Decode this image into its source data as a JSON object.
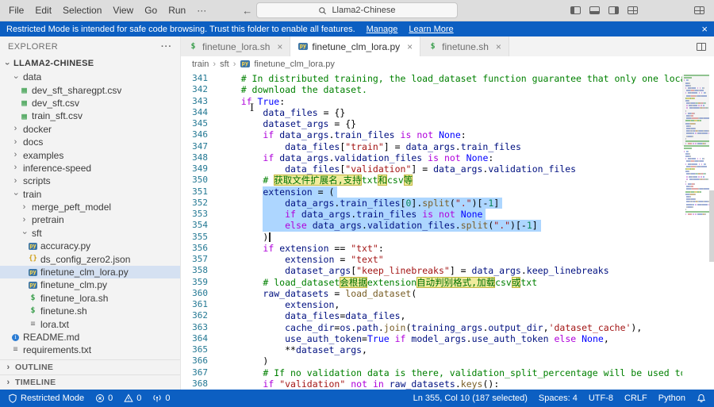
{
  "title_bar": {
    "menus": [
      "File",
      "Edit",
      "Selection",
      "View",
      "Go",
      "Run",
      "···"
    ],
    "search": "Llama2-Chinese"
  },
  "banner": {
    "text": "Restricted Mode is intended for safe code browsing. Trust this folder to enable all features.",
    "links": [
      "Manage",
      "Learn More"
    ]
  },
  "sidebar": {
    "header": "EXPLORER",
    "root": "LLAMA2-CHINESE",
    "items": [
      {
        "label": "data",
        "indent": 1,
        "chevron": "down"
      },
      {
        "label": "dev_sft_sharegpt.csv",
        "indent": 2,
        "icon": "csv"
      },
      {
        "label": "dev_sft.csv",
        "indent": 2,
        "icon": "csv"
      },
      {
        "label": "train_sft.csv",
        "indent": 2,
        "icon": "csv"
      },
      {
        "label": "docker",
        "indent": 1,
        "chevron": "right"
      },
      {
        "label": "docs",
        "indent": 1,
        "chevron": "right"
      },
      {
        "label": "examples",
        "indent": 1,
        "chevron": "right"
      },
      {
        "label": "inference-speed",
        "indent": 1,
        "chevron": "right"
      },
      {
        "label": "scripts",
        "indent": 1,
        "chevron": "right"
      },
      {
        "label": "train",
        "indent": 1,
        "chevron": "down"
      },
      {
        "label": "merge_peft_model",
        "indent": 2,
        "chevron": "right"
      },
      {
        "label": "pretrain",
        "indent": 2,
        "chevron": "right"
      },
      {
        "label": "sft",
        "indent": 2,
        "chevron": "down"
      },
      {
        "label": "accuracy.py",
        "indent": 3,
        "icon": "python"
      },
      {
        "label": "ds_config_zero2.json",
        "indent": 3,
        "icon": "json"
      },
      {
        "label": "finetune_clm_lora.py",
        "indent": 3,
        "icon": "python",
        "selected": true
      },
      {
        "label": "finetune_clm.py",
        "indent": 3,
        "icon": "python"
      },
      {
        "label": "finetune_lora.sh",
        "indent": 3,
        "icon": "shell"
      },
      {
        "label": "finetune.sh",
        "indent": 3,
        "icon": "shell"
      },
      {
        "label": "lora.txt",
        "indent": 3,
        "icon": "text"
      },
      {
        "label": "README.md",
        "indent": 1,
        "icon": "info"
      },
      {
        "label": "requirements.txt",
        "indent": 1,
        "icon": "text"
      }
    ],
    "sections": [
      "OUTLINE",
      "TIMELINE"
    ]
  },
  "tabs": [
    {
      "label": "finetune_lora.sh",
      "icon": "shell",
      "active": false
    },
    {
      "label": "finetune_clm_lora.py",
      "icon": "python",
      "active": true
    },
    {
      "label": "finetune.sh",
      "icon": "shell",
      "active": false
    }
  ],
  "breadcrumb": [
    "train",
    "sft",
    "finetune_clm_lora.py"
  ],
  "editor": {
    "lines": [
      {
        "n": 341,
        "pre": "    ",
        "tokens": [
          [
            "c",
            "# In distributed training, the load_dataset function guarantee that only one local process can concurrently"
          ]
        ]
      },
      {
        "n": 342,
        "pre": "    ",
        "tokens": [
          [
            "c",
            "# download the dataset."
          ]
        ]
      },
      {
        "n": 343,
        "pre": "    ",
        "tokens": [
          [
            "k",
            "if"
          ],
          [
            "p",
            " "
          ],
          [
            "b",
            "True"
          ],
          [
            "p",
            ":"
          ]
        ]
      },
      {
        "n": 344,
        "pre": "        ",
        "tokens": [
          [
            "v",
            "data_files"
          ],
          [
            "p",
            " = {}"
          ]
        ]
      },
      {
        "n": 345,
        "pre": "        ",
        "tokens": [
          [
            "v",
            "dataset_args"
          ],
          [
            "p",
            " = {}"
          ]
        ]
      },
      {
        "n": 346,
        "pre": "        ",
        "tokens": [
          [
            "k",
            "if"
          ],
          [
            "p",
            " "
          ],
          [
            "v",
            "data_args"
          ],
          [
            "p",
            "."
          ],
          [
            "v",
            "train_files"
          ],
          [
            "p",
            " "
          ],
          [
            "k",
            "is"
          ],
          [
            "p",
            " "
          ],
          [
            "k",
            "not"
          ],
          [
            "p",
            " "
          ],
          [
            "b",
            "None"
          ],
          [
            "p",
            ":"
          ]
        ]
      },
      {
        "n": 347,
        "pre": "            ",
        "tokens": [
          [
            "v",
            "data_files"
          ],
          [
            "p",
            "["
          ],
          [
            "s",
            "\"train\""
          ],
          [
            "p",
            "] = "
          ],
          [
            "v",
            "data_args"
          ],
          [
            "p",
            "."
          ],
          [
            "v",
            "train_files"
          ]
        ]
      },
      {
        "n": 348,
        "pre": "        ",
        "tokens": [
          [
            "k",
            "if"
          ],
          [
            "p",
            " "
          ],
          [
            "v",
            "data_args"
          ],
          [
            "p",
            "."
          ],
          [
            "v",
            "validation_files"
          ],
          [
            "p",
            " "
          ],
          [
            "k",
            "is"
          ],
          [
            "p",
            " "
          ],
          [
            "k",
            "not"
          ],
          [
            "p",
            " "
          ],
          [
            "b",
            "None"
          ],
          [
            "p",
            ":"
          ]
        ]
      },
      {
        "n": 349,
        "pre": "            ",
        "tokens": [
          [
            "v",
            "data_files"
          ],
          [
            "p",
            "["
          ],
          [
            "s",
            "\"validation\""
          ],
          [
            "p",
            "] = "
          ],
          [
            "v",
            "data_args"
          ],
          [
            "p",
            "."
          ],
          [
            "v",
            "validation_files"
          ]
        ]
      },
      {
        "n": 350,
        "pre": "        ",
        "tokens": [
          [
            "c",
            "# "
          ],
          [
            "hl",
            "获取文件扩展名,支持"
          ],
          [
            "c",
            "txt"
          ],
          [
            "hl",
            "和"
          ],
          [
            "c",
            "csv"
          ],
          [
            "hl",
            "等"
          ]
        ]
      },
      {
        "n": 351,
        "pre": "        ",
        "sel": true,
        "tokens": [
          [
            "v",
            "extension"
          ],
          [
            "p",
            " = ("
          ]
        ]
      },
      {
        "n": 352,
        "pre": "        ",
        "sel": true,
        "tokens": [
          [
            "p",
            "    "
          ],
          [
            "v",
            "data_args"
          ],
          [
            "p",
            "."
          ],
          [
            "v",
            "train_files"
          ],
          [
            "p",
            "["
          ],
          [
            "n",
            "0"
          ],
          [
            "p",
            "]."
          ],
          [
            "f",
            "split"
          ],
          [
            "p",
            "("
          ],
          [
            "s",
            "\".\""
          ],
          [
            "p",
            ")[-"
          ],
          [
            "n",
            "1"
          ],
          [
            "p",
            "]"
          ]
        ]
      },
      {
        "n": 353,
        "pre": "        ",
        "sel": true,
        "tokens": [
          [
            "p",
            "    "
          ],
          [
            "k",
            "if"
          ],
          [
            "p",
            " "
          ],
          [
            "v",
            "data_args"
          ],
          [
            "p",
            "."
          ],
          [
            "v",
            "train_files"
          ],
          [
            "p",
            " "
          ],
          [
            "k",
            "is"
          ],
          [
            "p",
            " "
          ],
          [
            "k",
            "not"
          ],
          [
            "p",
            " "
          ],
          [
            "b",
            "None"
          ]
        ]
      },
      {
        "n": 354,
        "pre": "        ",
        "sel": true,
        "tokens": [
          [
            "p",
            "    "
          ],
          [
            "k",
            "else"
          ],
          [
            "p",
            " "
          ],
          [
            "v",
            "data_args"
          ],
          [
            "p",
            "."
          ],
          [
            "v",
            "validation_files"
          ],
          [
            "p",
            "."
          ],
          [
            "f",
            "split"
          ],
          [
            "p",
            "("
          ],
          [
            "s",
            "\".\""
          ],
          [
            "p",
            ")[-"
          ],
          [
            "n",
            "1"
          ],
          [
            "p",
            "]"
          ]
        ]
      },
      {
        "n": 355,
        "pre": "        ",
        "cursor": true,
        "tokens": [
          [
            "p",
            ")"
          ]
        ]
      },
      {
        "n": 356,
        "pre": "        ",
        "tokens": [
          [
            "k",
            "if"
          ],
          [
            "p",
            " "
          ],
          [
            "v",
            "extension"
          ],
          [
            "p",
            " == "
          ],
          [
            "s",
            "\"txt\""
          ],
          [
            "p",
            ":"
          ]
        ]
      },
      {
        "n": 357,
        "pre": "            ",
        "tokens": [
          [
            "v",
            "extension"
          ],
          [
            "p",
            " = "
          ],
          [
            "s",
            "\"text\""
          ]
        ]
      },
      {
        "n": 358,
        "pre": "            ",
        "tokens": [
          [
            "v",
            "dataset_args"
          ],
          [
            "p",
            "["
          ],
          [
            "s",
            "\"keep_linebreaks\""
          ],
          [
            "p",
            "] = "
          ],
          [
            "v",
            "data_args"
          ],
          [
            "p",
            "."
          ],
          [
            "v",
            "keep_linebreaks"
          ]
        ]
      },
      {
        "n": 359,
        "pre": "        ",
        "tokens": [
          [
            "c",
            "# load_dataset"
          ],
          [
            "hl",
            "会根据"
          ],
          [
            "c",
            "extension"
          ],
          [
            "hl",
            "自动判别格式,加载"
          ],
          [
            "c",
            "csv"
          ],
          [
            "hl",
            "或"
          ],
          [
            "c",
            "txt"
          ]
        ]
      },
      {
        "n": 360,
        "pre": "        ",
        "tokens": [
          [
            "v",
            "raw_datasets"
          ],
          [
            "p",
            " = "
          ],
          [
            "f",
            "load_dataset"
          ],
          [
            "p",
            "("
          ]
        ]
      },
      {
        "n": 361,
        "pre": "            ",
        "tokens": [
          [
            "v",
            "extension"
          ],
          [
            "p",
            ","
          ]
        ]
      },
      {
        "n": 362,
        "pre": "            ",
        "tokens": [
          [
            "v",
            "data_files"
          ],
          [
            "p",
            "="
          ],
          [
            "v",
            "data_files"
          ],
          [
            "p",
            ","
          ]
        ]
      },
      {
        "n": 363,
        "pre": "            ",
        "tokens": [
          [
            "v",
            "cache_dir"
          ],
          [
            "p",
            "="
          ],
          [
            "v",
            "os"
          ],
          [
            "p",
            "."
          ],
          [
            "v",
            "path"
          ],
          [
            "p",
            "."
          ],
          [
            "f",
            "join"
          ],
          [
            "p",
            "("
          ],
          [
            "v",
            "training_args"
          ],
          [
            "p",
            "."
          ],
          [
            "v",
            "output_dir"
          ],
          [
            "p",
            ","
          ],
          [
            "s",
            "'dataset_cache'"
          ],
          [
            "p",
            "),"
          ]
        ]
      },
      {
        "n": 364,
        "pre": "            ",
        "tokens": [
          [
            "v",
            "use_auth_token"
          ],
          [
            "p",
            "="
          ],
          [
            "b",
            "True"
          ],
          [
            "p",
            " "
          ],
          [
            "k",
            "if"
          ],
          [
            "p",
            " "
          ],
          [
            "v",
            "model_args"
          ],
          [
            "p",
            "."
          ],
          [
            "v",
            "use_auth_token"
          ],
          [
            "p",
            " "
          ],
          [
            "k",
            "else"
          ],
          [
            "p",
            " "
          ],
          [
            "b",
            "None"
          ],
          [
            "p",
            ","
          ]
        ]
      },
      {
        "n": 365,
        "pre": "            ",
        "tokens": [
          [
            "p",
            "**"
          ],
          [
            "v",
            "dataset_args"
          ],
          [
            "p",
            ","
          ]
        ]
      },
      {
        "n": 366,
        "pre": "        ",
        "tokens": [
          [
            "p",
            ")"
          ]
        ]
      },
      {
        "n": 367,
        "pre": "        ",
        "tokens": [
          [
            "c",
            "# If no validation data is there, validation_split_percentage will be used to divide the dataset."
          ]
        ]
      },
      {
        "n": 368,
        "pre": "        ",
        "tokens": [
          [
            "k",
            "if"
          ],
          [
            "p",
            " "
          ],
          [
            "s",
            "\"validation\""
          ],
          [
            "p",
            " "
          ],
          [
            "k",
            "not"
          ],
          [
            "p",
            " "
          ],
          [
            "k",
            "in"
          ],
          [
            "p",
            " "
          ],
          [
            "v",
            "raw_datasets"
          ],
          [
            "p",
            "."
          ],
          [
            "f",
            "keys"
          ],
          [
            "p",
            "():"
          ]
        ]
      }
    ]
  },
  "status_bar": {
    "left": [
      {
        "icon": "shield",
        "label": "Restricted Mode"
      },
      {
        "icon": "error",
        "label": "0"
      },
      {
        "icon": "warning",
        "label": "0"
      },
      {
        "icon": "broadcast",
        "label": "0"
      }
    ],
    "right": [
      "Ln 355, Col 10 (187 selected)",
      "Spaces: 4",
      "UTF-8",
      "CRLF",
      "Python"
    ]
  }
}
